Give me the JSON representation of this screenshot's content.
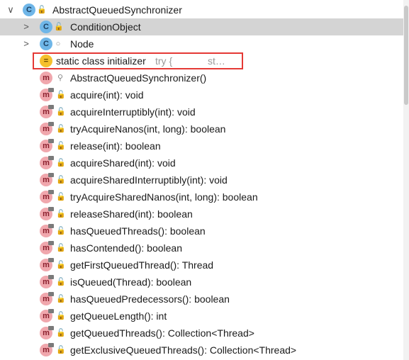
{
  "root": {
    "arrow": "∨",
    "icon": "class-icon",
    "label": "AbstractQueuedSynchronizer"
  },
  "inner": [
    {
      "arrow": ">",
      "label": "ConditionObject",
      "visibility": "public"
    },
    {
      "arrow": ">",
      "label": "Node",
      "visibility": "package"
    }
  ],
  "initializer": {
    "label": "static class initializer",
    "hint1": "try {",
    "hint2": "st…"
  },
  "constructor": {
    "label": "AbstractQueuedSynchronizer()",
    "visibility": "private"
  },
  "methods": [
    "acquire(int): void",
    "acquireInterruptibly(int): void",
    "tryAcquireNanos(int, long): boolean",
    "release(int): boolean",
    "acquireShared(int): void",
    "acquireSharedInterruptibly(int): void",
    "tryAcquireSharedNanos(int, long): boolean",
    "releaseShared(int): boolean",
    "hasQueuedThreads(): boolean",
    "hasContended(): boolean",
    "getFirstQueuedThread(): Thread",
    "isQueued(Thread): boolean",
    "hasQueuedPredecessors(): boolean",
    "getQueueLength(): int",
    "getQueuedThreads(): Collection<Thread>",
    "getExclusiveQueuedThreads(): Collection<Thread>"
  ],
  "icon_letters": {
    "class": "C",
    "method": "m",
    "init": "="
  },
  "colors": {
    "selection": "#d4d4d4",
    "highlight": "#e53935"
  }
}
